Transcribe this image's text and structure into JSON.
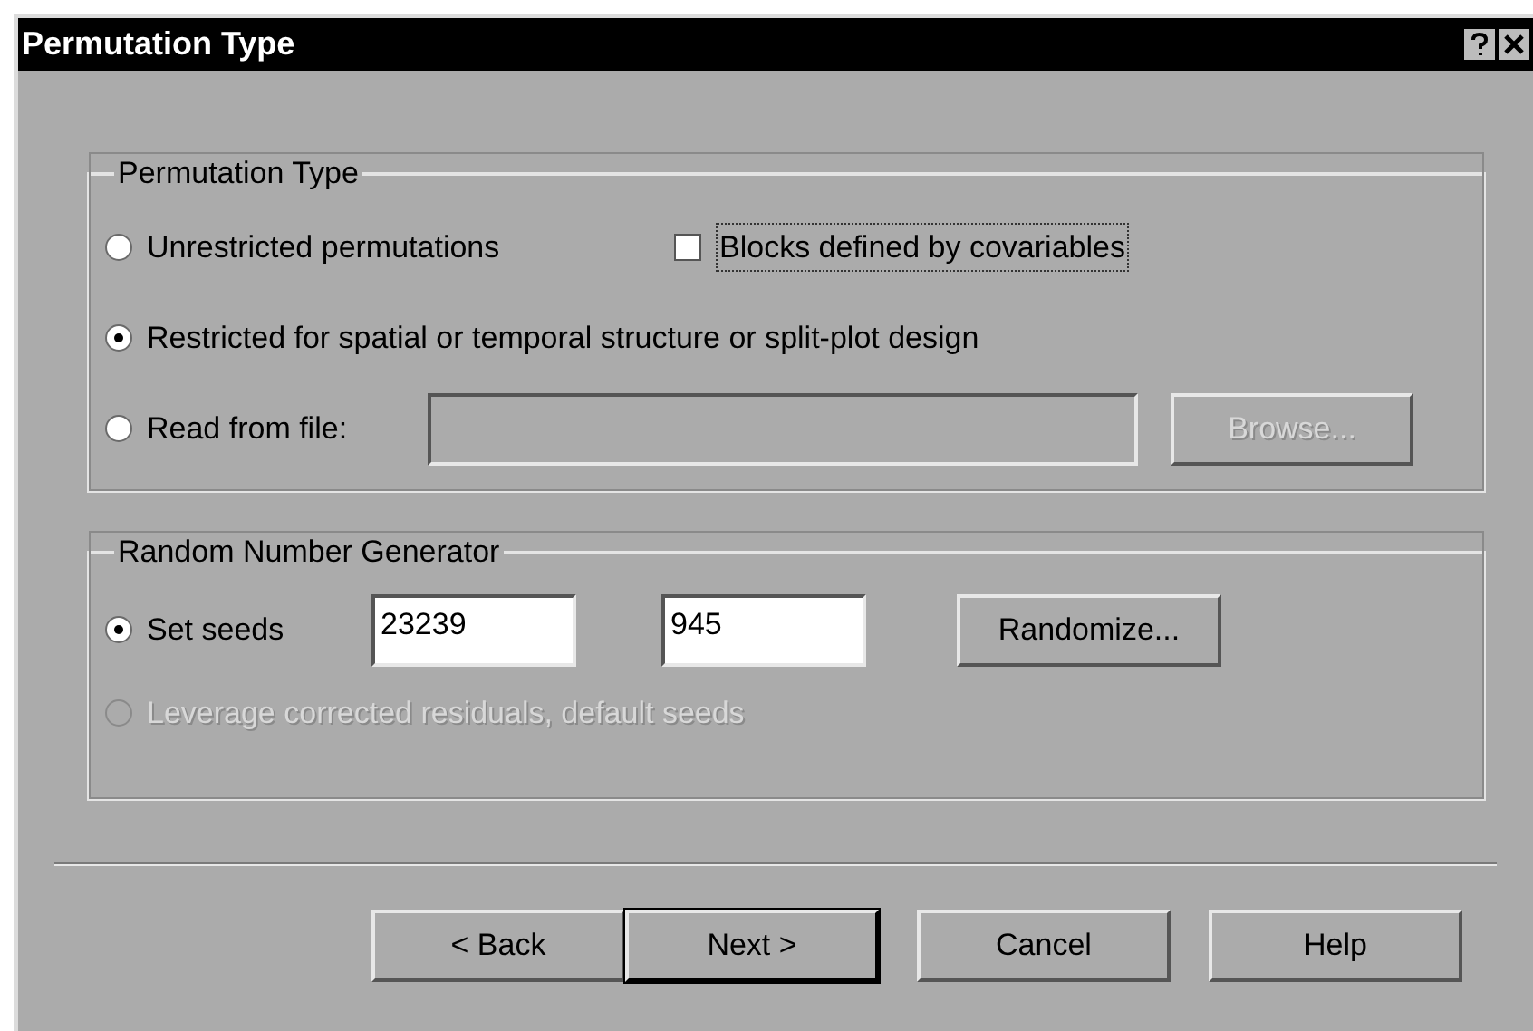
{
  "window": {
    "title": "Permutation Type"
  },
  "permutation_group": {
    "title": "Permutation Type",
    "options": [
      {
        "label": "Unrestricted permutations",
        "selected": false,
        "disabled": false
      },
      {
        "label": "Restricted for spatial or temporal structure or split-plot design",
        "selected": true,
        "disabled": false
      },
      {
        "label": "Read from file:",
        "selected": false,
        "disabled": false
      }
    ],
    "checkbox": {
      "label": "Blocks defined by covariables",
      "checked": false
    },
    "file_field": {
      "disabled": true
    },
    "browse_button": {
      "label": "Browse...",
      "disabled": true
    }
  },
  "rng_group": {
    "title": "Random Number Generator",
    "options": [
      {
        "label": "Set seeds",
        "selected": true,
        "disabled": false
      },
      {
        "label": "Leverage corrected residuals, default seeds",
        "selected": false,
        "disabled": true
      }
    ],
    "seeds": [
      "23239",
      "945"
    ],
    "randomize_button": {
      "label": "Randomize..."
    }
  },
  "buttons": [
    {
      "label": "< Back",
      "default": false
    },
    {
      "label": "Next >",
      "default": true
    },
    {
      "label": "Cancel",
      "default": false
    },
    {
      "label": "Help",
      "default": false
    }
  ]
}
